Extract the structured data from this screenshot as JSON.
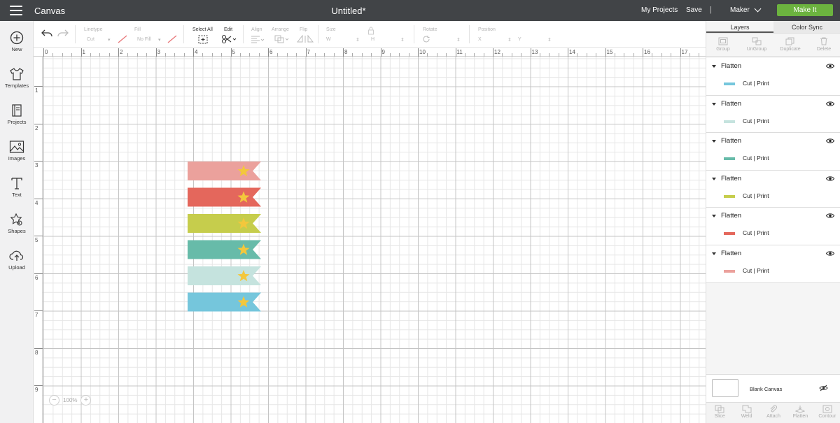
{
  "header": {
    "app_title": "Canvas",
    "doc_title": "Untitled*",
    "my_projects": "My Projects",
    "save": "Save",
    "separator": "|",
    "machine": "Maker",
    "make_it": "Make It"
  },
  "sidebar": {
    "items": [
      {
        "label": "New",
        "icon": "plus-circle-icon"
      },
      {
        "label": "Templates",
        "icon": "tshirt-icon"
      },
      {
        "label": "Projects",
        "icon": "book-icon"
      },
      {
        "label": "Images",
        "icon": "image-icon"
      },
      {
        "label": "Text",
        "icon": "text-t-icon"
      },
      {
        "label": "Shapes",
        "icon": "shapes-icon"
      },
      {
        "label": "Upload",
        "icon": "cloud-upload-icon"
      }
    ]
  },
  "toolbar": {
    "linetype_label": "Linetype",
    "linetype_value": "Cut",
    "fill_label": "Fill",
    "fill_value": "No Fill",
    "select_all": "Select All",
    "edit": "Edit",
    "align": "Align",
    "arrange": "Arrange",
    "flip": "Flip",
    "size": "Size",
    "size_w": "W",
    "size_h": "H",
    "rotate": "Rotate",
    "position": "Position",
    "pos_x": "X",
    "pos_y": "Y"
  },
  "ruler": {
    "top": [
      "0",
      "1",
      "2",
      "3",
      "4",
      "5",
      "6",
      "7",
      "8",
      "9",
      "10",
      "11",
      "12",
      "13",
      "14",
      "15",
      "16",
      "17"
    ],
    "left": [
      "1",
      "2",
      "3",
      "4",
      "5",
      "6",
      "7",
      "8",
      "9"
    ]
  },
  "canvas": {
    "zoom": "100%",
    "flags": [
      {
        "color": "#eba19c"
      },
      {
        "color": "#e4675c"
      },
      {
        "color": "#c6cd4c"
      },
      {
        "color": "#67bba9"
      },
      {
        "color": "#c5e3de"
      },
      {
        "color": "#75c6dc"
      }
    ],
    "star_color": "#f3c73c"
  },
  "panel": {
    "tab_layers": "Layers",
    "tab_color_sync": "Color Sync",
    "actions": [
      "Group",
      "UnGroup",
      "Duplicate",
      "Delete"
    ],
    "layers": [
      {
        "name": "Flatten",
        "ops": "Cut  | Print",
        "color": "#75c6dc"
      },
      {
        "name": "Flatten",
        "ops": "Cut  | Print",
        "color": "#c5e3de"
      },
      {
        "name": "Flatten",
        "ops": "Cut  | Print",
        "color": "#67bba9"
      },
      {
        "name": "Flatten",
        "ops": "Cut  | Print",
        "color": "#c6cd4c"
      },
      {
        "name": "Flatten",
        "ops": "Cut  | Print",
        "color": "#e4675c"
      },
      {
        "name": "Flatten",
        "ops": "Cut  | Print",
        "color": "#eba19c"
      }
    ],
    "blank_canvas": "Blank Canvas",
    "bottom_actions": [
      "Slice",
      "Weld",
      "Attach",
      "Flatten",
      "Contour"
    ]
  },
  "colors": {
    "topbar": "#414447",
    "make_it": "#6cb33f"
  }
}
